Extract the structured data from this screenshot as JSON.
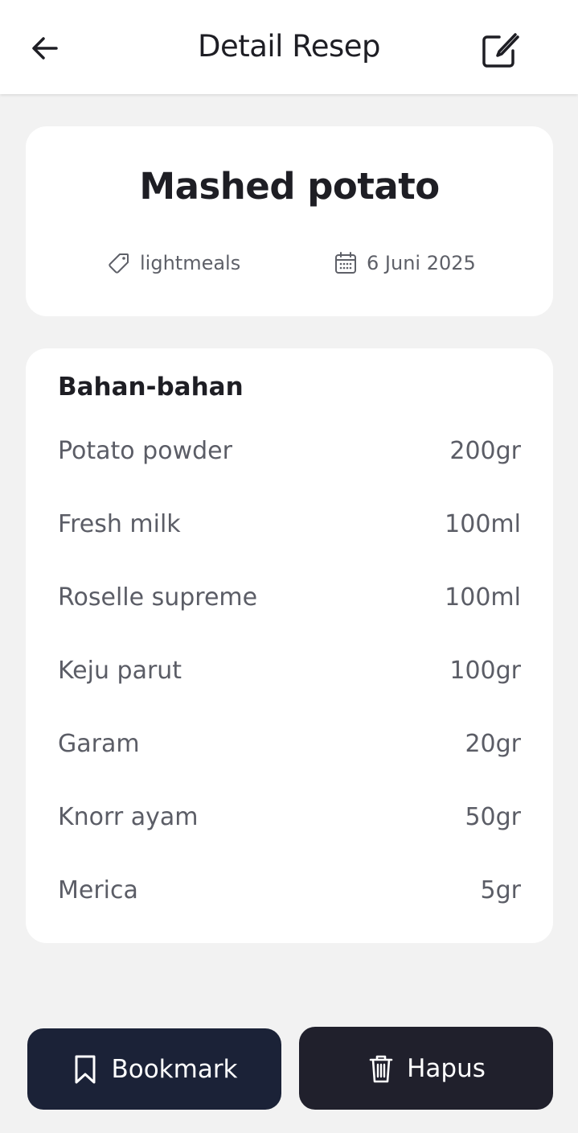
{
  "header": {
    "title": "Detail Resep",
    "back_icon": "arrow-left-icon",
    "edit_icon": "edit-icon"
  },
  "recipe": {
    "title": "Mashed potato",
    "category": "lightmeals",
    "category_icon": "tag-icon",
    "date": "6 Juni 2025",
    "date_icon": "calendar-icon"
  },
  "ingredients": {
    "heading": "Bahan-bahan",
    "items": [
      {
        "name": "Potato powder",
        "amount": "200gr"
      },
      {
        "name": "Fresh milk",
        "amount": "100ml"
      },
      {
        "name": "Roselle supreme",
        "amount": "100ml"
      },
      {
        "name": "Keju parut",
        "amount": "100gr"
      },
      {
        "name": "Garam",
        "amount": "20gr"
      },
      {
        "name": "Knorr ayam",
        "amount": "50gr"
      },
      {
        "name": "Merica",
        "amount": "5gr"
      }
    ]
  },
  "actions": {
    "bookmark_label": "Bookmark",
    "bookmark_icon": "bookmark-icon",
    "delete_label": "Hapus",
    "delete_icon": "trash-icon"
  },
  "colors": {
    "bookmark_button": "#1b2237",
    "delete_button": "#20202c",
    "background": "#f2f2f2",
    "card": "#ffffff"
  }
}
